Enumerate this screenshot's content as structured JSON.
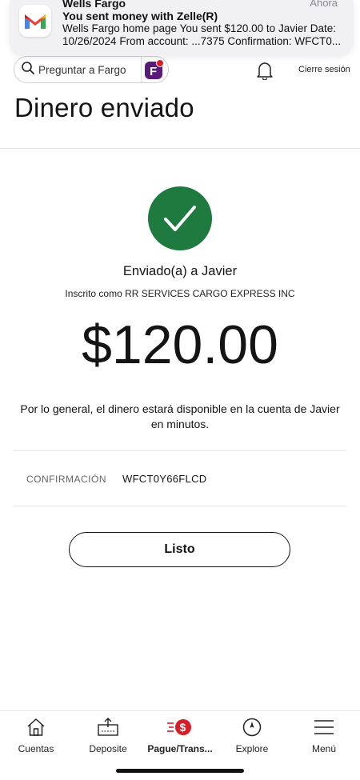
{
  "notification": {
    "app_icon": "gmail-icon",
    "sender": "Wells Fargo",
    "time": "Ahora",
    "subject": "You sent money with Zelle(R)",
    "body": "Wells Fargo home page You sent $120.00 to Javier Date: 10/26/2024 From account: ...7375 Confirmation: WFCT0..."
  },
  "header": {
    "search_label": "Preguntar a Fargo",
    "signout_label": "Cierre sesión"
  },
  "page": {
    "title": "Dinero enviado"
  },
  "confirmation": {
    "sent_to": "Enviado(a) a Javier",
    "enrolled_as": "Inscrito como RR SERVICES CARGO EXPRESS INC",
    "amount": "$120.00",
    "availability": "Por lo general, el dinero estará disponible en la cuenta de Javier en minutos.",
    "confirmation_label": "CONFIRMACIÓN",
    "confirmation_number": "WFCT0Y66FLCD",
    "done_label": "Listo"
  },
  "nav": {
    "items": [
      {
        "label": "Cuentas",
        "icon": "home-icon"
      },
      {
        "label": "Deposite",
        "icon": "deposit-icon"
      },
      {
        "label": "Pague/Trans...",
        "icon": "pay-transfer-icon",
        "active": true
      },
      {
        "label": "Explore",
        "icon": "compass-icon"
      },
      {
        "label": "Menú",
        "icon": "hamburger-icon"
      }
    ]
  },
  "colors": {
    "success_green": "#1f7a3f",
    "accent_red": "#d71e28",
    "fargo_purple": "#5a1a7a"
  }
}
